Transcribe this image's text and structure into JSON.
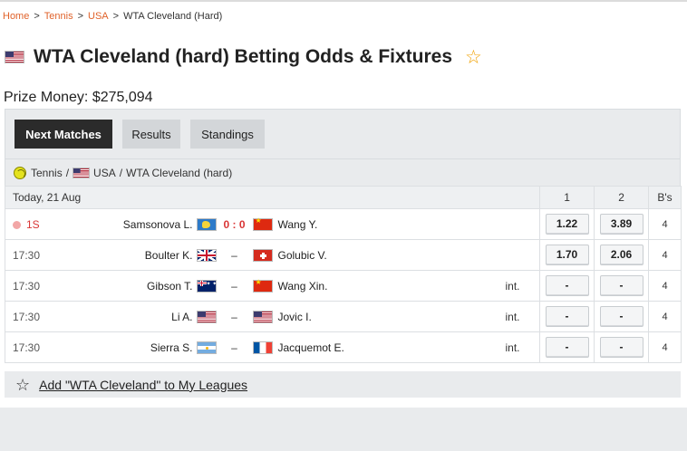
{
  "breadcrumb": {
    "items": [
      "Home",
      "Tennis",
      "USA"
    ],
    "current": "WTA Cleveland (Hard)",
    "separator": ">"
  },
  "header": {
    "title": "WTA Cleveland (hard) Betting Odds & Fixtures",
    "flag_icon": "us-flag-icon",
    "favorite_icon": "star-outline-icon"
  },
  "prize": {
    "text": "Prize Money: $275,094"
  },
  "tabs": [
    {
      "label": "Next Matches",
      "active": true
    },
    {
      "label": "Results",
      "active": false
    },
    {
      "label": "Standings",
      "active": false
    }
  ],
  "subnav": {
    "sport": "Tennis",
    "sep1": "/",
    "country": "USA",
    "sep2": "/",
    "league": "WTA Cleveland (hard)"
  },
  "table": {
    "date_header": "Today, 21 Aug",
    "col_1": "1",
    "col_2": "2",
    "col_bs": "B's",
    "rows": [
      {
        "time": "1S",
        "live": true,
        "home": "Samsonova L.",
        "home_flag": "world",
        "score": "0 : 0",
        "away": "Wang Y.",
        "away_flag": "cn",
        "info": "",
        "odd1": "1.22",
        "odd2": "3.89",
        "bs": "4"
      },
      {
        "time": "17:30",
        "live": false,
        "home": "Boulter K.",
        "home_flag": "gb",
        "score": "–",
        "away": "Golubic V.",
        "away_flag": "ch",
        "info": "",
        "odd1": "1.70",
        "odd2": "2.06",
        "bs": "4"
      },
      {
        "time": "17:30",
        "live": false,
        "home": "Gibson T.",
        "home_flag": "au",
        "score": "–",
        "away": "Wang Xin.",
        "away_flag": "cn",
        "info": "int.",
        "odd1": "-",
        "odd2": "-",
        "bs": "4"
      },
      {
        "time": "17:30",
        "live": false,
        "home": "Li A.",
        "home_flag": "us",
        "score": "–",
        "away": "Jovic I.",
        "away_flag": "us",
        "info": "int.",
        "odd1": "-",
        "odd2": "-",
        "bs": "4"
      },
      {
        "time": "17:30",
        "live": false,
        "home": "Sierra S.",
        "home_flag": "ar",
        "score": "–",
        "away": "Jacquemot E.",
        "away_flag": "fr",
        "info": "int.",
        "odd1": "-",
        "odd2": "-",
        "bs": "4"
      }
    ]
  },
  "add_league": {
    "label": "Add \"WTA Cleveland\" to My Leagues"
  },
  "colors": {
    "accent": "#e0622a",
    "live": "#d93636",
    "star": "#f0a000",
    "tab_active": "#2b2b2b"
  }
}
